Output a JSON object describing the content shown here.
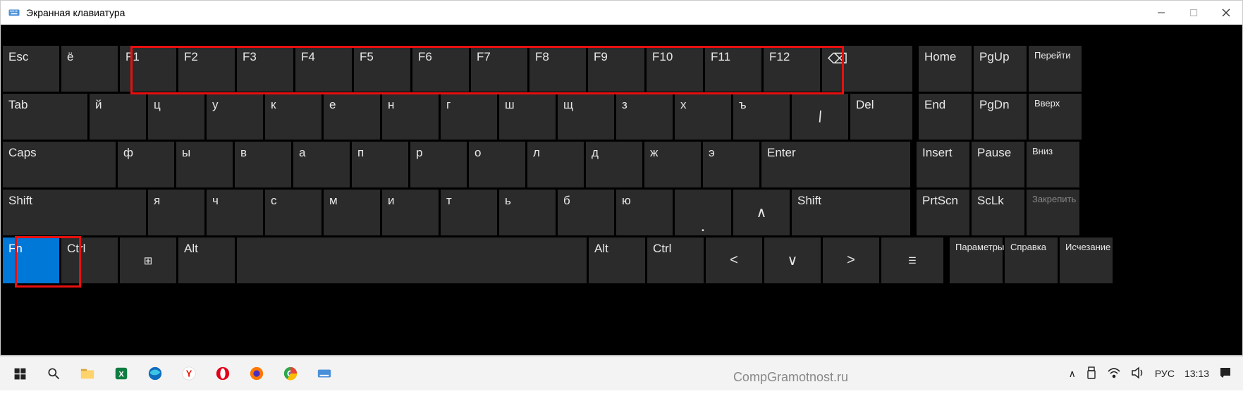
{
  "title": "Экранная клавиатура",
  "rows": {
    "r1": [
      "Esc",
      "ё",
      "F1",
      "F2",
      "F3",
      "F4",
      "F5",
      "F6",
      "F7",
      "F8",
      "F9",
      "F10",
      "F11",
      "F12",
      "⌫"
    ],
    "r1_side": [
      "Home",
      "PgUp",
      "Перейти"
    ],
    "r2": [
      "Tab",
      "й",
      "ц",
      "у",
      "к",
      "е",
      "н",
      "г",
      "ш",
      "щ",
      "з",
      "х",
      "ъ",
      "\\",
      "Del"
    ],
    "r2_side": [
      "End",
      "PgDn",
      "Вверх"
    ],
    "r3": [
      "Caps",
      "ф",
      "ы",
      "в",
      "а",
      "п",
      "р",
      "о",
      "л",
      "д",
      "ж",
      "э",
      "Enter"
    ],
    "r3_side": [
      "Insert",
      "Pause",
      "Вниз"
    ],
    "r4": [
      "Shift",
      "я",
      "ч",
      "с",
      "м",
      "и",
      "т",
      "ь",
      "б",
      "ю",
      ".",
      "∧",
      "Shift"
    ],
    "r4_side": [
      "PrtScn",
      "ScLk",
      "Закрепить"
    ],
    "r5": [
      "Fn",
      "Ctrl",
      "⊞",
      "Alt",
      " ",
      "Alt",
      "Ctrl",
      "<",
      "∨",
      ">",
      "☰"
    ],
    "r5_side": [
      "Параметры",
      "Справка",
      "Исчезание"
    ]
  },
  "taskbar": {
    "watermark": "CompGramotnost.ru",
    "lang": "РУС",
    "time": "13:13"
  }
}
